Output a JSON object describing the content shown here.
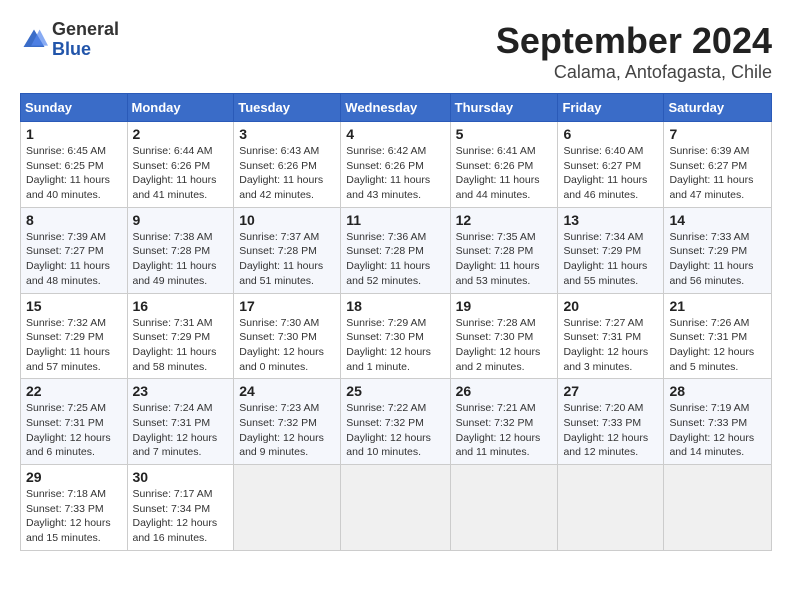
{
  "header": {
    "logo_general": "General",
    "logo_blue": "Blue",
    "month_title": "September 2024",
    "location": "Calama, Antofagasta, Chile"
  },
  "days_of_week": [
    "Sunday",
    "Monday",
    "Tuesday",
    "Wednesday",
    "Thursday",
    "Friday",
    "Saturday"
  ],
  "weeks": [
    [
      {
        "day": "1",
        "sunrise": "6:45 AM",
        "sunset": "6:25 PM",
        "daylight": "11 hours and 40 minutes."
      },
      {
        "day": "2",
        "sunrise": "6:44 AM",
        "sunset": "6:26 PM",
        "daylight": "11 hours and 41 minutes."
      },
      {
        "day": "3",
        "sunrise": "6:43 AM",
        "sunset": "6:26 PM",
        "daylight": "11 hours and 42 minutes."
      },
      {
        "day": "4",
        "sunrise": "6:42 AM",
        "sunset": "6:26 PM",
        "daylight": "11 hours and 43 minutes."
      },
      {
        "day": "5",
        "sunrise": "6:41 AM",
        "sunset": "6:26 PM",
        "daylight": "11 hours and 44 minutes."
      },
      {
        "day": "6",
        "sunrise": "6:40 AM",
        "sunset": "6:27 PM",
        "daylight": "11 hours and 46 minutes."
      },
      {
        "day": "7",
        "sunrise": "6:39 AM",
        "sunset": "6:27 PM",
        "daylight": "11 hours and 47 minutes."
      }
    ],
    [
      {
        "day": "8",
        "sunrise": "7:39 AM",
        "sunset": "7:27 PM",
        "daylight": "11 hours and 48 minutes."
      },
      {
        "day": "9",
        "sunrise": "7:38 AM",
        "sunset": "7:28 PM",
        "daylight": "11 hours and 49 minutes."
      },
      {
        "day": "10",
        "sunrise": "7:37 AM",
        "sunset": "7:28 PM",
        "daylight": "11 hours and 51 minutes."
      },
      {
        "day": "11",
        "sunrise": "7:36 AM",
        "sunset": "7:28 PM",
        "daylight": "11 hours and 52 minutes."
      },
      {
        "day": "12",
        "sunrise": "7:35 AM",
        "sunset": "7:28 PM",
        "daylight": "11 hours and 53 minutes."
      },
      {
        "day": "13",
        "sunrise": "7:34 AM",
        "sunset": "7:29 PM",
        "daylight": "11 hours and 55 minutes."
      },
      {
        "day": "14",
        "sunrise": "7:33 AM",
        "sunset": "7:29 PM",
        "daylight": "11 hours and 56 minutes."
      }
    ],
    [
      {
        "day": "15",
        "sunrise": "7:32 AM",
        "sunset": "7:29 PM",
        "daylight": "11 hours and 57 minutes."
      },
      {
        "day": "16",
        "sunrise": "7:31 AM",
        "sunset": "7:29 PM",
        "daylight": "11 hours and 58 minutes."
      },
      {
        "day": "17",
        "sunrise": "7:30 AM",
        "sunset": "7:30 PM",
        "daylight": "12 hours and 0 minutes."
      },
      {
        "day": "18",
        "sunrise": "7:29 AM",
        "sunset": "7:30 PM",
        "daylight": "12 hours and 1 minute."
      },
      {
        "day": "19",
        "sunrise": "7:28 AM",
        "sunset": "7:30 PM",
        "daylight": "12 hours and 2 minutes."
      },
      {
        "day": "20",
        "sunrise": "7:27 AM",
        "sunset": "7:31 PM",
        "daylight": "12 hours and 3 minutes."
      },
      {
        "day": "21",
        "sunrise": "7:26 AM",
        "sunset": "7:31 PM",
        "daylight": "12 hours and 5 minutes."
      }
    ],
    [
      {
        "day": "22",
        "sunrise": "7:25 AM",
        "sunset": "7:31 PM",
        "daylight": "12 hours and 6 minutes."
      },
      {
        "day": "23",
        "sunrise": "7:24 AM",
        "sunset": "7:31 PM",
        "daylight": "12 hours and 7 minutes."
      },
      {
        "day": "24",
        "sunrise": "7:23 AM",
        "sunset": "7:32 PM",
        "daylight": "12 hours and 9 minutes."
      },
      {
        "day": "25",
        "sunrise": "7:22 AM",
        "sunset": "7:32 PM",
        "daylight": "12 hours and 10 minutes."
      },
      {
        "day": "26",
        "sunrise": "7:21 AM",
        "sunset": "7:32 PM",
        "daylight": "12 hours and 11 minutes."
      },
      {
        "day": "27",
        "sunrise": "7:20 AM",
        "sunset": "7:33 PM",
        "daylight": "12 hours and 12 minutes."
      },
      {
        "day": "28",
        "sunrise": "7:19 AM",
        "sunset": "7:33 PM",
        "daylight": "12 hours and 14 minutes."
      }
    ],
    [
      {
        "day": "29",
        "sunrise": "7:18 AM",
        "sunset": "7:33 PM",
        "daylight": "12 hours and 15 minutes."
      },
      {
        "day": "30",
        "sunrise": "7:17 AM",
        "sunset": "7:34 PM",
        "daylight": "12 hours and 16 minutes."
      },
      null,
      null,
      null,
      null,
      null
    ]
  ]
}
